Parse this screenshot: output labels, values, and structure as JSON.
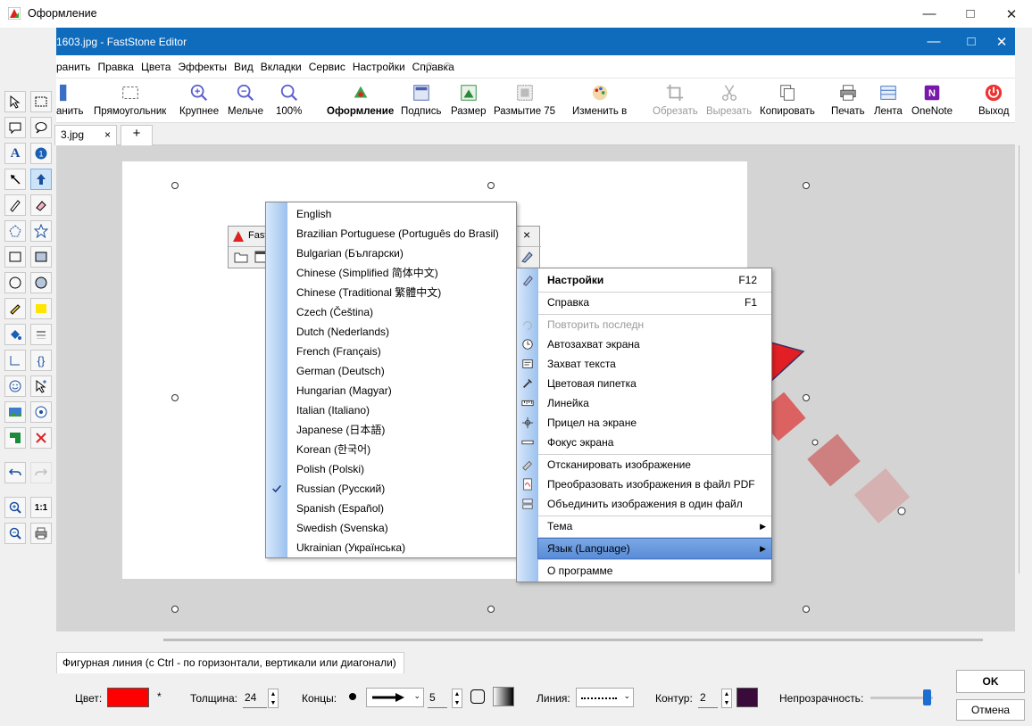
{
  "outer_window": {
    "title": "Оформление"
  },
  "fs_window": {
    "title": "1603.jpg - FastStone Editor"
  },
  "menu": [
    "ранить",
    "Правка",
    "Цвета",
    "Эффекты",
    "Вид",
    "Вкладки",
    "Сервис",
    "Настройки",
    "Справка"
  ],
  "toolbar": {
    "save": "анить",
    "rectangle": "Прямоугольник",
    "zoom_in": "Крупнее",
    "zoom_out": "Мельче",
    "zoom_100": "100%",
    "decorate": "Оформление",
    "caption": "Подпись",
    "resize": "Размер",
    "blur": "Размытие 75",
    "convert": "Изменить в",
    "crop": "Обрезать",
    "cut": "Вырезать",
    "copy": "Копировать",
    "print": "Печать",
    "ribbon": "Лента",
    "onenote": "OneNote",
    "exit": "Выход"
  },
  "tabs": {
    "file_tab": "3.jpg",
    "close": "×",
    "add": "+"
  },
  "language_menu": {
    "items": [
      "English",
      "Brazilian Portuguese (Português do Brasil)",
      "Bulgarian (Български)",
      "Chinese (Simplified 简体中文)",
      "Chinese (Traditional 繁體中文)",
      "Czech (Čeština)",
      "Dutch (Nederlands)",
      "French (Français)",
      "German (Deutsch)",
      "Hungarian (Magyar)",
      "Italian (Italiano)",
      "Japanese (日本語)",
      "Korean (한국어)",
      "Polish (Polski)",
      "Russian (Русский)",
      "Spanish (Español)",
      "Swedish (Svenska)",
      "Ukrainian (Українська)"
    ],
    "checked": "Russian (Русский)"
  },
  "mini_window": {
    "title": "Fast",
    "close": "×"
  },
  "settings_menu": {
    "settings": "Настройки",
    "settings_shortcut": "F12",
    "help": "Справка",
    "help_shortcut": "F1",
    "repeat": "Повторить последн",
    "autocapture": "Автозахват экрана",
    "text_capture": "Захват текста",
    "color_picker": "Цветовая пипетка",
    "ruler": "Линейка",
    "crosshair": "Прицел на экране",
    "focus": "Фокус экрана",
    "scan": "Отсканировать изображение",
    "to_pdf": "Преобразовать изображения в файл PDF",
    "merge": "Объединить изображения в один файл",
    "theme": "Тема",
    "language": "Язык (Language)",
    "about": "О программе"
  },
  "bottom": {
    "hint": "Фигурная линия (с Ctrl - по горизонтали, вертикали или диагонали)",
    "color_label": "Цвет:",
    "color_value": "#ff0000",
    "star": "*",
    "thickness_label": "Толщина:",
    "thickness_value": "24",
    "ends_label": "Концы:",
    "ends_value": "5",
    "line_label": "Линия:",
    "contour_label": "Контур:",
    "contour_value": "2",
    "contour_color": "#3a0b3a",
    "opacity_label": "Непрозрачность:",
    "opacity_value": 0.9,
    "ok": "OK",
    "cancel": "Отмена"
  },
  "colors": {
    "accent": "#0f6cbd",
    "arrow": "#e8262b"
  }
}
